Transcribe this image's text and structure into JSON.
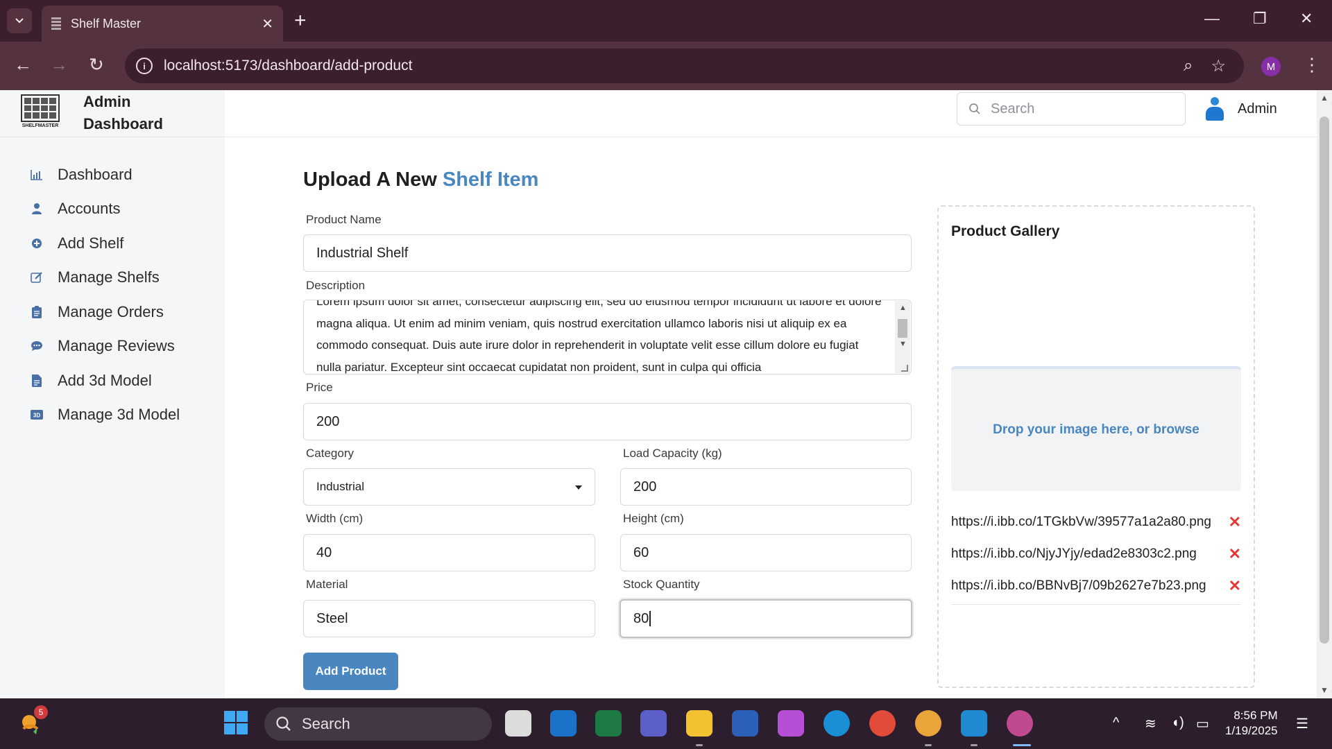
{
  "browser": {
    "tab_title": "Shelf Master",
    "url": "localhost:5173/dashboard/add-product",
    "profile_initial": "M"
  },
  "brand": {
    "logo_text": "SHELFMASTER",
    "title": "Admin Dashboard"
  },
  "sidebar": {
    "items": [
      {
        "label": "Dashboard",
        "icon": "bar-chart-icon"
      },
      {
        "label": "Accounts",
        "icon": "user-icon"
      },
      {
        "label": "Add Shelf",
        "icon": "plus-circle-icon"
      },
      {
        "label": "Manage Shelfs",
        "icon": "edit-icon"
      },
      {
        "label": "Manage Orders",
        "icon": "clipboard-icon"
      },
      {
        "label": "Manage Reviews",
        "icon": "chat-icon"
      },
      {
        "label": "Add 3d Model",
        "icon": "file-icon"
      },
      {
        "label": "Manage 3d Model",
        "icon": "3d-icon"
      }
    ]
  },
  "header": {
    "search_placeholder": "Search",
    "user_name": "Admin"
  },
  "form": {
    "title_prefix": "Upload A New",
    "title_accent": "Shelf Item",
    "product_name_label": "Product Name",
    "product_name": "Industrial Shelf",
    "description_label": "Description",
    "description": "Lorem ipsum dolor sit amet, consectetur adipiscing elit, sed do eiusmod tempor incididunt ut labore et dolore magna aliqua. Ut enim ad minim veniam, quis nostrud exercitation ullamco laboris nisi ut aliquip ex ea commodo consequat. Duis aute irure dolor in reprehenderit in voluptate velit esse cillum dolore eu fugiat nulla pariatur. Excepteur sint occaecat cupidatat non proident, sunt in culpa qui officia",
    "price_label": "Price",
    "price": "200",
    "category_label": "Category",
    "category": "Industrial",
    "load_label": "Load Capacity (kg)",
    "load": "200",
    "width_label": "Width (cm)",
    "width": "40",
    "height_label": "Height (cm)",
    "height": "60",
    "material_label": "Material",
    "material": "Steel",
    "stock_label": "Stock Quantity",
    "stock": "80",
    "submit_label": "Add Product"
  },
  "gallery": {
    "title": "Product Gallery",
    "drop_text": "Drop your image here, or browse",
    "urls": [
      "https://i.ibb.co/1TGkbVw/39577a1a2a80.png",
      "https://i.ibb.co/NjyJYjy/edad2e8303c2.png",
      "https://i.ibb.co/BBNvBj7/09b2627e7b23.png"
    ]
  },
  "taskbar": {
    "search_label": "Search",
    "time": "8:56 PM",
    "date": "1/19/2025",
    "notification_count": "5"
  }
}
